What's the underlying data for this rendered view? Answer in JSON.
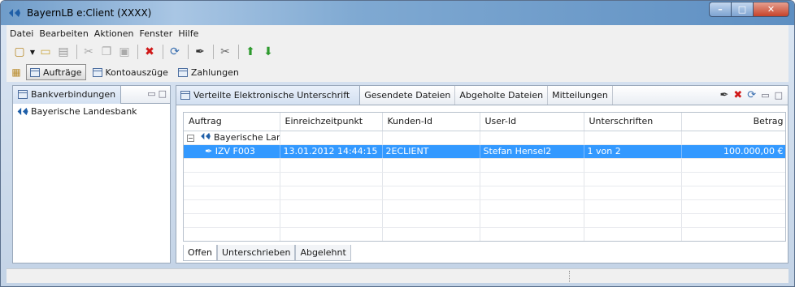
{
  "window": {
    "title": "BayernLB e:Client (XXXX)"
  },
  "menu": [
    "Datei",
    "Bearbeiten",
    "Aktionen",
    "Fenster",
    "Hilfe"
  ],
  "nav": {
    "tabs": [
      {
        "label": "Aufträge",
        "active": true
      },
      {
        "label": "Kontoauszüge",
        "active": false
      },
      {
        "label": "Zahlungen",
        "active": false
      }
    ]
  },
  "left": {
    "tab": "Bankverbindungen",
    "tree": [
      "Bayerische Landesbank"
    ]
  },
  "right": {
    "tabs": [
      "Verteilte Elektronische Unterschrift",
      "Gesendete Dateien",
      "Abgeholte Dateien",
      "Mitteilungen"
    ],
    "table": {
      "columns": [
        "Auftrag",
        "Einreichzeitpunkt",
        "Kunden-Id",
        "User-Id",
        "Unterschriften",
        "Betrag"
      ],
      "group": "Bayerische Land",
      "row": {
        "auftrag": "IZV F003",
        "zeit": "13.01.2012 14:44:15",
        "kunde": "2ECLIENT",
        "user": "Stefan Hensel2",
        "unterschriften": "1 von 2",
        "betrag": "100.000,00 €"
      }
    },
    "bottom_tabs": [
      "Offen",
      "Unterschrieben",
      "Abgelehnt"
    ]
  },
  "colors": {
    "selection": "#3399ff",
    "brand": "#1f5fa8"
  }
}
